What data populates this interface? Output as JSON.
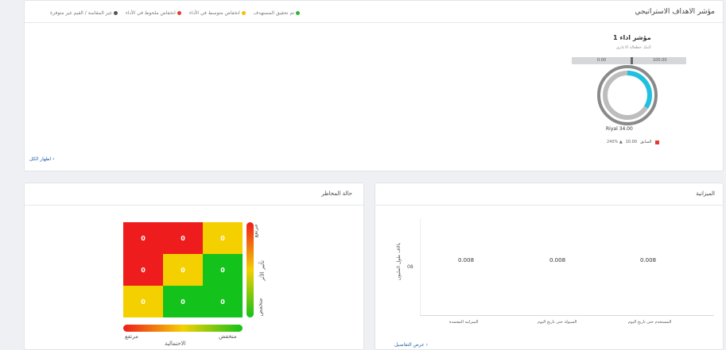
{
  "goals": {
    "title": "مؤشر الاهداف الاستراتيجي",
    "legend": [
      {
        "label": "تم تحقيق المستهدف",
        "color": "#2eb82e"
      },
      {
        "label": "انخفاض متوسط في الأداء",
        "color": "#f2c200"
      },
      {
        "label": "انخفاض ملحوظ في الأداء",
        "color": "#e53935"
      },
      {
        "label": "غير المقاسة / القيم غير متوفرة",
        "color": "#555555"
      }
    ],
    "kpi": {
      "title": "مؤشر اداء 1",
      "subtitle": "البنك خطعالة الاعاري",
      "range_min": "0.00",
      "range_max": "100.00",
      "progress_fraction": 0.34,
      "value": "Riyal 34.00",
      "previous_label": "السابق",
      "previous_value": "10.00",
      "change": "240% ▲"
    },
    "show_all": "اظهار الكل ›"
  },
  "risk": {
    "title": "حالة المخاطر",
    "cells": [
      [
        "0",
        "0",
        "0"
      ],
      [
        "0",
        "0",
        "0"
      ],
      [
        "0",
        "0",
        "0"
      ]
    ],
    "cell_colors": [
      [
        "#ee1c1c",
        "#ee1c1c",
        "#f5d000"
      ],
      [
        "#ee1c1c",
        "#f5d000",
        "#13c21a"
      ],
      [
        "#f5d000",
        "#13c21a",
        "#13c21a"
      ]
    ],
    "impact_label": "تأثير الأثر",
    "impact_high": "مرتفع",
    "impact_low": "منخفض",
    "prob_high": "مرتفع",
    "prob_low": "منخفض",
    "prob_label": "الاحتمالية"
  },
  "budget": {
    "title": "الميزانية",
    "details_link": "عرض التفاصيل ›",
    "chart_data": {
      "type": "bar",
      "categories": [
        "المستخدم حتى تاريخ اليوم",
        "السيولة حتى تاريخ اليوم",
        "الميزانية المعتمدة"
      ],
      "values": [
        "0.008",
        "0.008",
        "0.008"
      ],
      "ylabel": "بالاف طول المليون",
      "ytick": "08"
    }
  }
}
